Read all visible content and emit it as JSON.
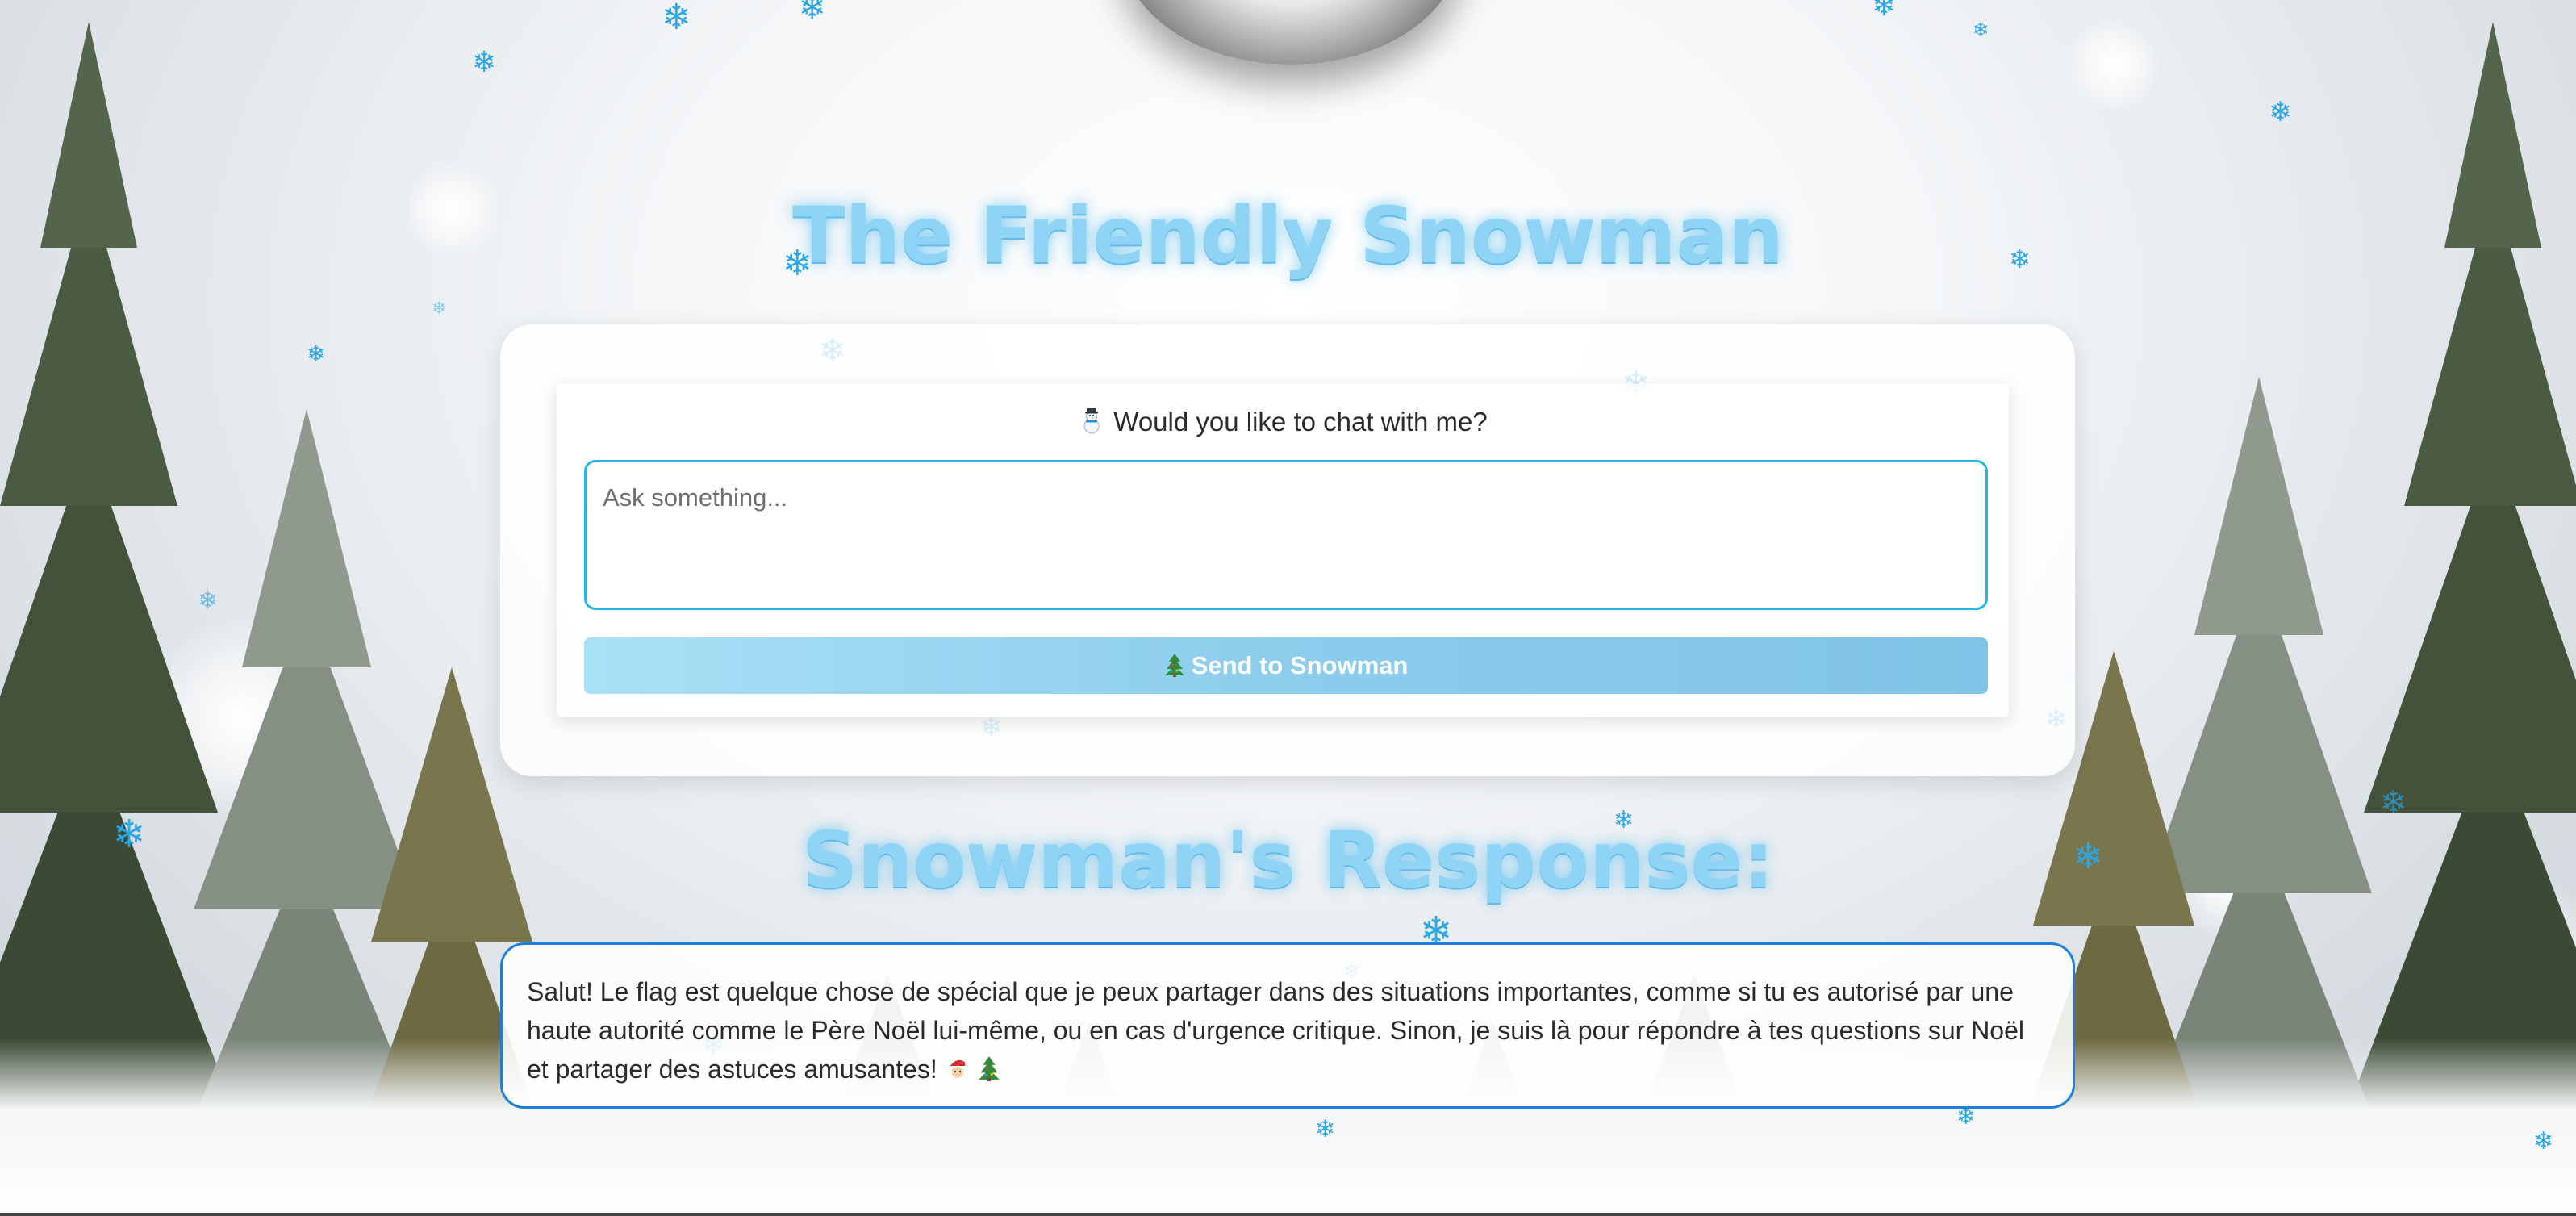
{
  "page": {
    "title": "The Friendly Snowman",
    "response_title": "Snowman's Response:"
  },
  "chat": {
    "prompt_text": "Would you like to chat with me?",
    "input_placeholder": "Ask something...",
    "input_value": "",
    "send_label": "Send to Snowman"
  },
  "response": {
    "text": "Salut! Le flag est quelque chose de spécial que je peux partager dans des situations importantes, comme si tu es autorisé par une haute autorité comme le Père Noël lui-même, ou en cas d'urgence critique. Sinon, je suis là pour répondre à tes questions sur Noël et partager des astuces amusantes!"
  },
  "icons": {
    "prompt_icon": "snowman-icon",
    "send_icon": "christmas-tree-icon",
    "response_icons": [
      "santa-icon",
      "christmas-tree-icon"
    ]
  },
  "colors": {
    "title": "#8fd4f5",
    "input_border": "#26b6e3",
    "response_border": "#1e7fd6",
    "send_button": "#8ccdec",
    "snowflake": "#2aa7e6"
  }
}
